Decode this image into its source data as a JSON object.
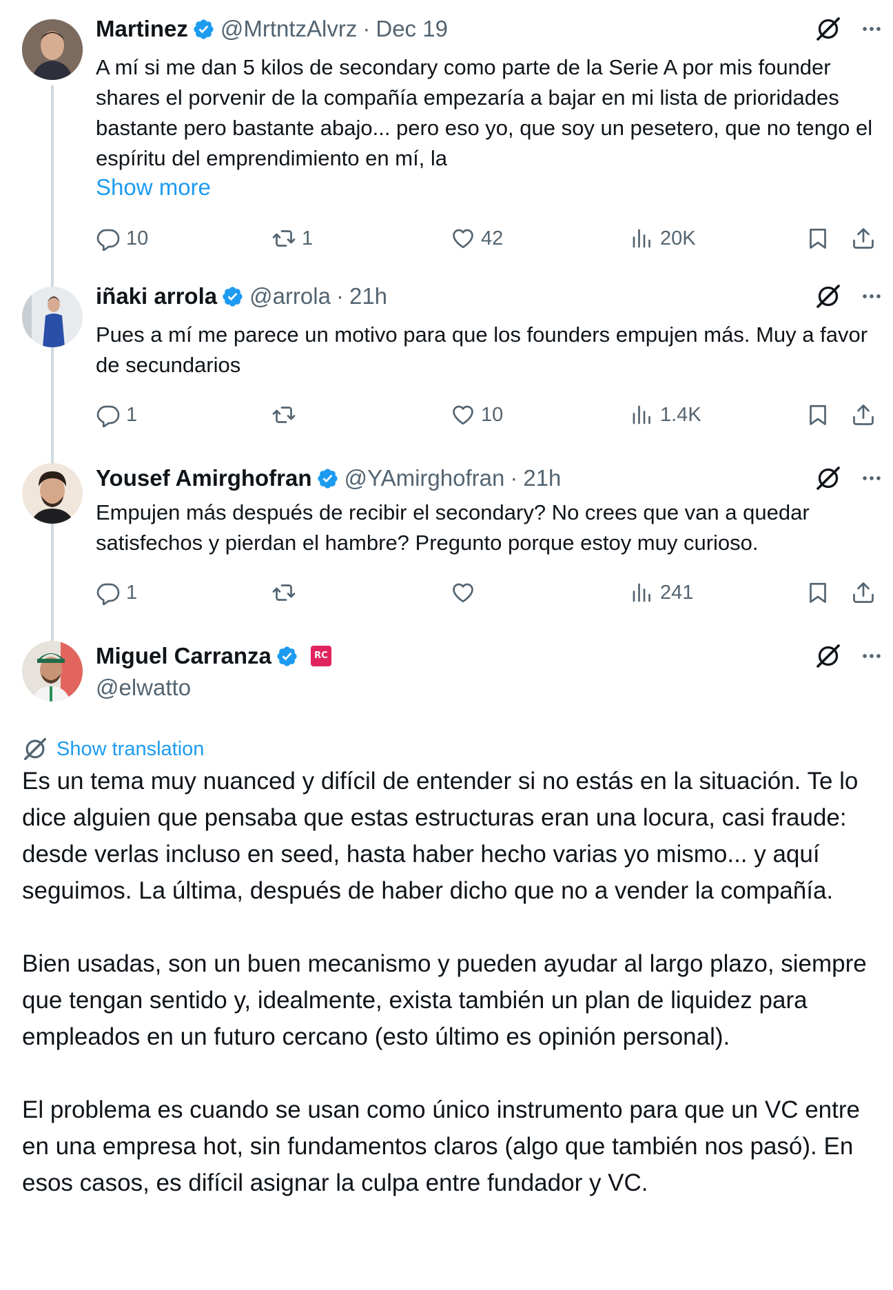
{
  "tweets": [
    {
      "name": "Martinez",
      "handle": "@MrtntzAlvrz",
      "time": "Dec 19",
      "text": "A mí si me dan 5 kilos de secondary como parte de la Serie A por mis founder shares el porvenir de la compañía empezaría a bajar en mi lista de prioridades bastante pero bastante abajo... pero eso yo, que soy un pesetero, que no tengo el espíritu del emprendimiento en mí, la",
      "show_more": "Show more",
      "replies": "10",
      "reposts": "1",
      "likes": "42",
      "views": "20K"
    },
    {
      "name": "iñaki arrola",
      "handle": "@arrola",
      "time": "21h",
      "text": "Pues a mí me parece un motivo para que los founders empujen más. Muy a favor de secundarios",
      "replies": "1",
      "reposts": "",
      "likes": "10",
      "views": "1.4K"
    },
    {
      "name": "Yousef Amirghofran",
      "handle": "@YAmirghofran",
      "time": "21h",
      "text": "Empujen más después de recibir el secondary? No crees que van a quedar satisfechos y pierdan el hambre? Pregunto porque estoy muy curioso.",
      "replies": "1",
      "reposts": "",
      "likes": "",
      "views": "241"
    }
  ],
  "main_tweet": {
    "name": "Miguel Carranza",
    "handle": "@elwatto",
    "badge_text": "RC",
    "translation_label": "Show translation",
    "paragraphs": [
      "Es un tema muy nuanced y difícil de entender si no estás en la situación. Te lo dice alguien que pensaba que estas estructuras eran una locura, casi fraude: desde verlas incluso en seed, hasta haber hecho varias yo mismo... y aquí seguimos. La última, después de haber dicho que no a vender la compañía.",
      "Bien usadas, son un buen mecanismo y pueden ayudar al largo plazo, siempre que tengan sentido y, idealmente, exista también un plan de liquidez para empleados en un futuro cercano (esto último es opinión personal).",
      "El problema es cuando se usan como único instrumento para que un VC entre en una empresa hot, sin fundamentos claros (algo que también nos pasó). En esos casos, es difícil asignar la culpa entre fundador y VC."
    ]
  },
  "colors": {
    "accent": "#1d9bf0",
    "text": "#0f1419",
    "secondary": "#536471",
    "thread_line": "#cfd9de"
  }
}
